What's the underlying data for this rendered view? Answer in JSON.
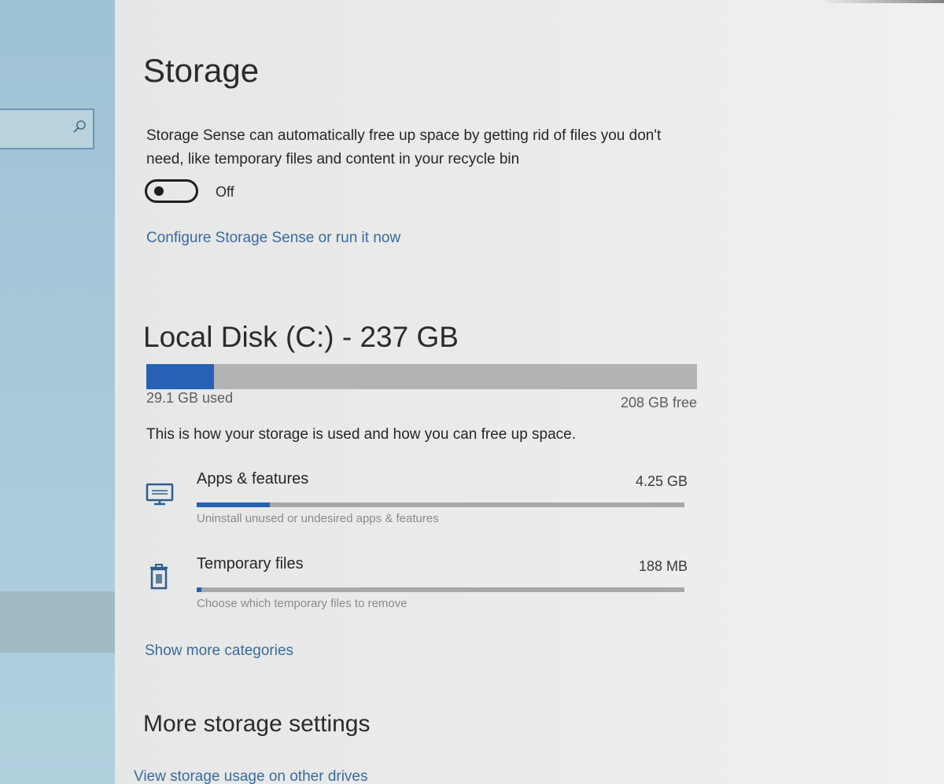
{
  "nav": {
    "search_icon": "search-icon"
  },
  "page": {
    "title": "Storage",
    "storage_sense_description": "Storage Sense can automatically free up space by getting rid of files you don't need, like temporary files and content in your recycle bin",
    "storage_sense_toggle": {
      "state": "Off",
      "on": false
    },
    "configure_link": "Configure Storage Sense or run it now"
  },
  "disk": {
    "title": "Local Disk (C:) - 237 GB",
    "used_label": "29.1 GB used",
    "free_label": "208 GB free",
    "used_fraction": 0.123,
    "usage_description": "This is how your storage is used and how you can free up space."
  },
  "categories": [
    {
      "name": "Apps & features",
      "size": "4.25 GB",
      "subtitle": "Uninstall unused or undesired apps & features",
      "icon": "monitor-icon",
      "fill_fraction": 0.15
    },
    {
      "name": "Temporary files",
      "size": "188 MB",
      "subtitle": "Choose which temporary files to remove",
      "icon": "trash-icon",
      "fill_fraction": 0.01
    }
  ],
  "show_more_link": "Show more categories",
  "more_settings": {
    "title": "More storage settings",
    "other_drives_link": "View storage usage on other drives"
  },
  "colors": {
    "accent": "#2661b5",
    "link": "#3a6a9e",
    "bar_track": "#b3b3b3"
  }
}
